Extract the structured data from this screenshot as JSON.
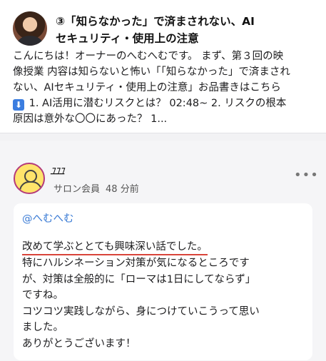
{
  "post": {
    "title_line1": "③「知らなかった」で済まされない、AI",
    "title_line2": "セキュリティ・使用上の注意",
    "body_line1": "こんにちは！オーナーのへむへむです。 まず、第３回の映",
    "body_line2": "像授業 内容は知らないと怖い「「知らなかった」で済まされ",
    "body_line3": "ない、AIセキュリティ・使用上の注意」お品書きはこちら",
    "body_line4_icon": "⬇",
    "body_line4": " 1. AI活用に潜むリスクとは？ 02:48~ 2. リスクの根本",
    "body_line5": "原因は意外な〇〇にあった？ 1..."
  },
  "comment": {
    "username": "ﾕﾕﾕ",
    "role": "サロン会員",
    "time": "48 分前",
    "more_icon": "•••",
    "mention": "@へむへむ",
    "lines": [
      "改めて学ぶととても興味深い話でした。",
      "特にハルシネーション対策が気になるところです",
      "が、対策は全般的に「ローマは1日にしてならず」",
      "ですね。",
      "コツコツ実践しながら、身につけていこうって思い",
      "ました。",
      "ありがとうございます！"
    ]
  },
  "colors": {
    "mention": "#3a7bd5",
    "underline": "#d9443a",
    "icon_blue": "#3b7de0",
    "avatar_yellow": "#ffe46b",
    "avatar_ring": "#b43a7a"
  }
}
